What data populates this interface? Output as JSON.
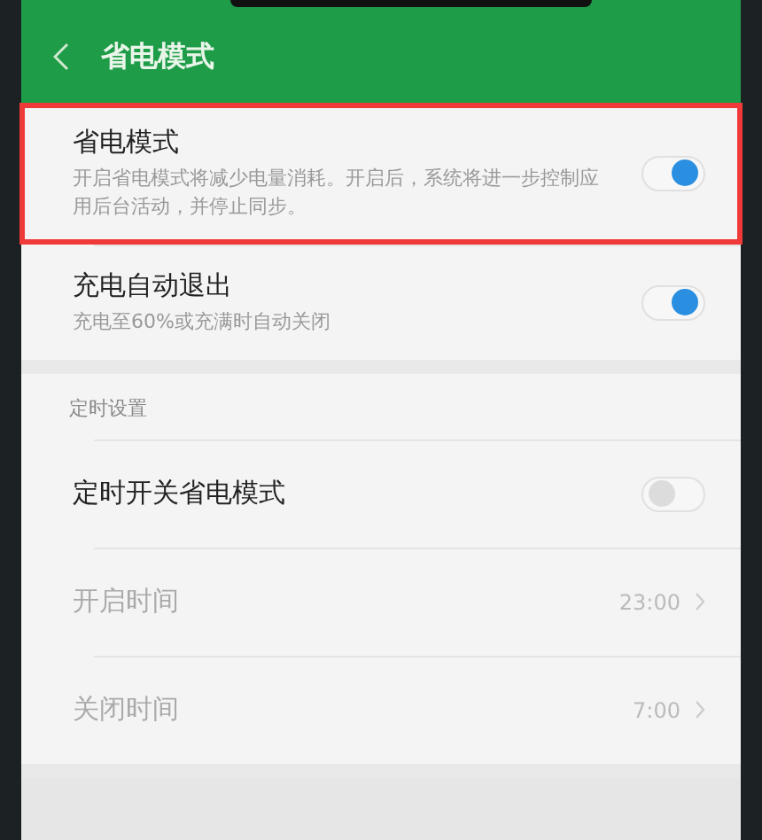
{
  "header": {
    "title": "省电模式"
  },
  "groups": [
    {
      "items": [
        {
          "kind": "toggle",
          "title": "省电模式",
          "subtitle": "开启省电模式将减少电量消耗。开启后，系统将进一步控制应用后台活动，并停止同步。",
          "on": true,
          "highlighted": true
        },
        {
          "kind": "toggle",
          "title": "充电自动退出",
          "subtitle": "充电至60%或充满时自动关闭",
          "on": true,
          "highlighted": false
        }
      ]
    },
    {
      "label": "定时设置",
      "items": [
        {
          "kind": "toggle",
          "title": "定时开关省电模式",
          "on": false,
          "highlighted": false
        },
        {
          "kind": "time",
          "title": "开启时间",
          "value": "23:00",
          "disabled": true
        },
        {
          "kind": "time",
          "title": "关闭时间",
          "value": "7:00",
          "disabled": true
        }
      ]
    }
  ]
}
